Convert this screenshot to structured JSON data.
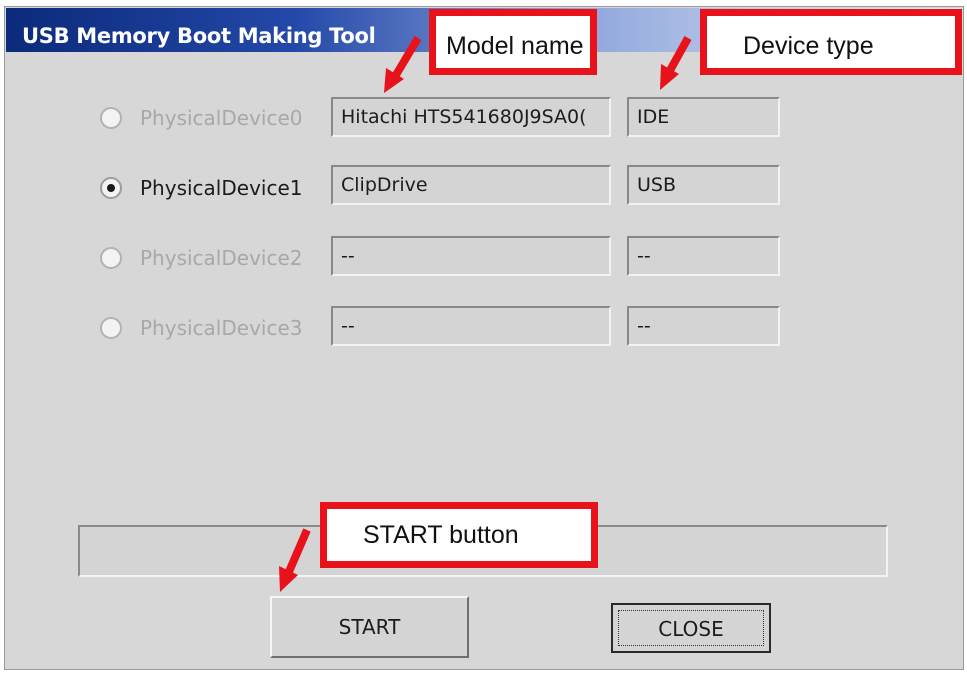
{
  "window": {
    "title": "USB Memory Boot Making Tool"
  },
  "devices": [
    {
      "label": "PhysicalDevice0",
      "model": "Hitachi HTS541680J9SA0(",
      "type": "IDE",
      "selected": false,
      "enabled": false
    },
    {
      "label": "PhysicalDevice1",
      "model": "ClipDrive",
      "type": "USB",
      "selected": true,
      "enabled": true
    },
    {
      "label": "PhysicalDevice2",
      "model": "--",
      "type": "--",
      "selected": false,
      "enabled": false
    },
    {
      "label": "PhysicalDevice3",
      "model": "--",
      "type": "--",
      "selected": false,
      "enabled": false
    }
  ],
  "buttons": {
    "start": "START",
    "close": "CLOSE"
  },
  "annotations": {
    "model_name": "Model name",
    "device_type": "Device type",
    "start_button": "START button",
    "color": "#e8121b"
  }
}
